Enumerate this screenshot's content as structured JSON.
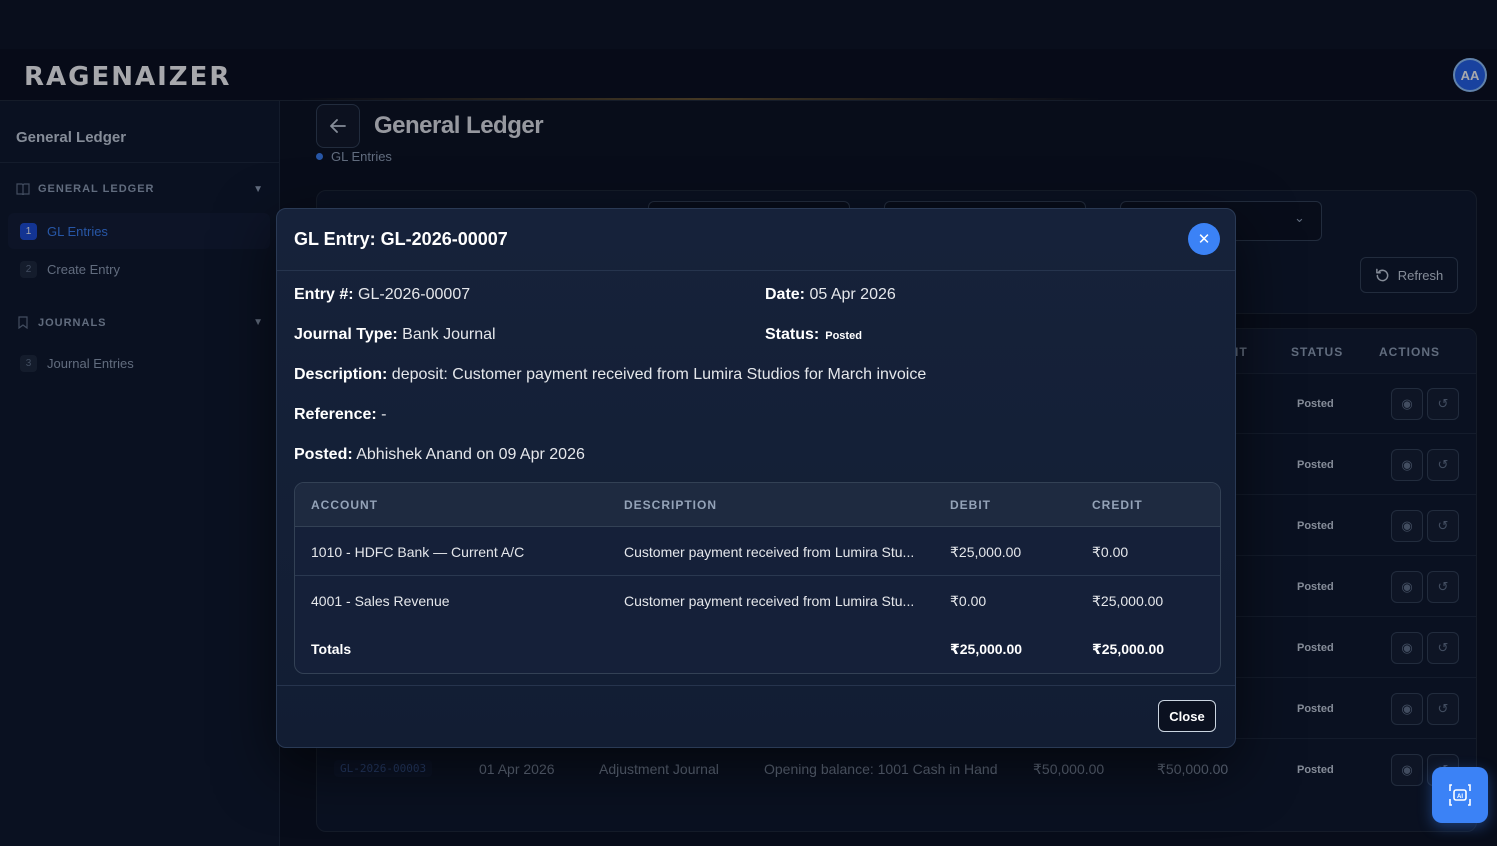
{
  "app": {
    "logo": "RAGENAIZER",
    "avatar_initials": "AA"
  },
  "sidebar": {
    "title": "General Ledger",
    "sections": [
      {
        "label": "GENERAL LEDGER",
        "items": [
          {
            "num": "1",
            "label": "GL Entries"
          },
          {
            "num": "2",
            "label": "Create Entry"
          }
        ]
      },
      {
        "label": "JOURNALS",
        "items": [
          {
            "num": "3",
            "label": "Journal Entries"
          }
        ]
      }
    ]
  },
  "page": {
    "title": "General Ledger",
    "breadcrumb": "GL Entries",
    "refresh_label": "Refresh"
  },
  "table": {
    "headers": {
      "partial_credit": "IT",
      "status": "STATUS",
      "actions": "ACTIONS"
    },
    "status_values": [
      "Posted",
      "Posted",
      "Posted",
      "Posted",
      "Posted",
      "Posted",
      "Posted"
    ],
    "last_row": {
      "entry": "GL-2026-00003",
      "date": "01 Apr 2026",
      "journal": "Adjustment Journal",
      "description": "Opening balance: 1001 Cash in Hand",
      "debit": "₹50,000.00",
      "credit": "₹50,000.00",
      "status": "Posted"
    }
  },
  "modal": {
    "title": "GL Entry: GL-2026-00007",
    "entry_label": "Entry #:",
    "entry_value": "GL-2026-00007",
    "date_label": "Date:",
    "date_value": "05 Apr 2026",
    "journal_label": "Journal Type:",
    "journal_value": "Bank Journal",
    "status_label": "Status:",
    "status_value": "Posted",
    "description_label": "Description:",
    "description_value": "deposit: Customer payment received from Lumira Studios for March invoice",
    "reference_label": "Reference:",
    "reference_value": "-",
    "posted_label": "Posted:",
    "posted_value": "Abhishek Anand on 09 Apr 2026",
    "lines": {
      "headers": {
        "account": "ACCOUNT",
        "description": "DESCRIPTION",
        "debit": "DEBIT",
        "credit": "CREDIT"
      },
      "rows": [
        {
          "account": "1010 - HDFC Bank — Current A/C",
          "description": "Customer payment received from Lumira Stu...",
          "debit": "₹25,000.00",
          "credit": "₹0.00"
        },
        {
          "account": "4001 - Sales Revenue",
          "description": "Customer payment received from Lumira Stu...",
          "debit": "₹0.00",
          "credit": "₹25,000.00"
        }
      ],
      "totals": {
        "label": "Totals",
        "debit": "₹25,000.00",
        "credit": "₹25,000.00"
      }
    },
    "close_label": "Close"
  }
}
